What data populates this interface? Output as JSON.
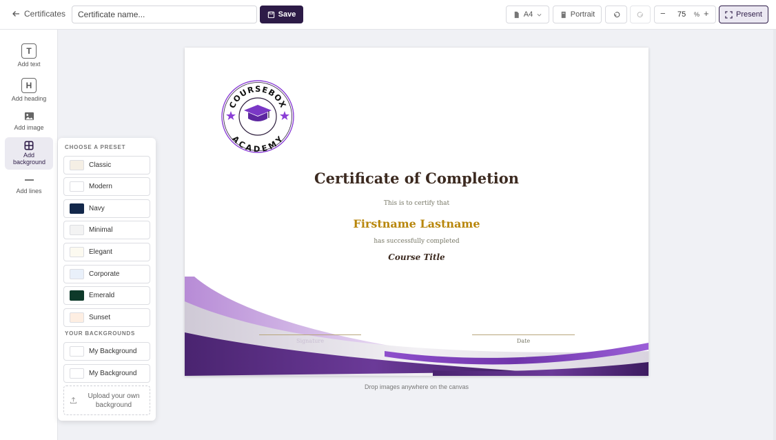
{
  "header": {
    "back_label": "Certificates",
    "name_placeholder": "Certificate name...",
    "save_label": "Save",
    "page_size": "A4",
    "orientation": "Portrait",
    "zoom_value": "75",
    "zoom_unit": "%",
    "present_label": "Present"
  },
  "tools": [
    {
      "label": "Add text",
      "icon": "text-icon"
    },
    {
      "label": "Add heading",
      "icon": "heading-icon"
    },
    {
      "label": "Add image",
      "icon": "image-icon"
    },
    {
      "label": "Add background",
      "icon": "grid-icon"
    },
    {
      "label": "Add lines",
      "icon": "line-icon"
    }
  ],
  "panel": {
    "presets_heading": "CHOOSE A PRESET",
    "presets": [
      {
        "label": "Classic",
        "color": "#f5efe5"
      },
      {
        "label": "Modern",
        "color": "#ffffff"
      },
      {
        "label": "Navy",
        "color": "#13284b"
      },
      {
        "label": "Minimal",
        "color": "#f3f3f3"
      },
      {
        "label": "Elegant",
        "color": "#fcfaf0"
      },
      {
        "label": "Corporate",
        "color": "#e9f0fa"
      },
      {
        "label": "Emerald",
        "color": "#0e3a2a"
      },
      {
        "label": "Sunset",
        "color": "#fdeee2"
      }
    ],
    "backgrounds_heading": "YOUR BACKGROUNDS",
    "backgrounds": [
      {
        "label": "My Background"
      },
      {
        "label": "My Background"
      }
    ],
    "upload_label": "Upload your own background"
  },
  "certificate": {
    "logo_top_text": "COURSEBOX",
    "logo_bottom_text": "ACADEMY",
    "title": "Certificate of Completion",
    "certify_text": "This is to certify that",
    "recipient_name": "Firstname Lastname",
    "completed_text": "has successfully completed",
    "course_title": "Course Title",
    "signature_label": "Signature",
    "date_label": "Date"
  },
  "canvas_hint": "Drop images anywhere on the canvas",
  "colors": {
    "brand": "#2d1b47",
    "logo_purple": "#8b3fd6",
    "wave_purple": "#5a2d82",
    "gold": "#b8860b"
  }
}
